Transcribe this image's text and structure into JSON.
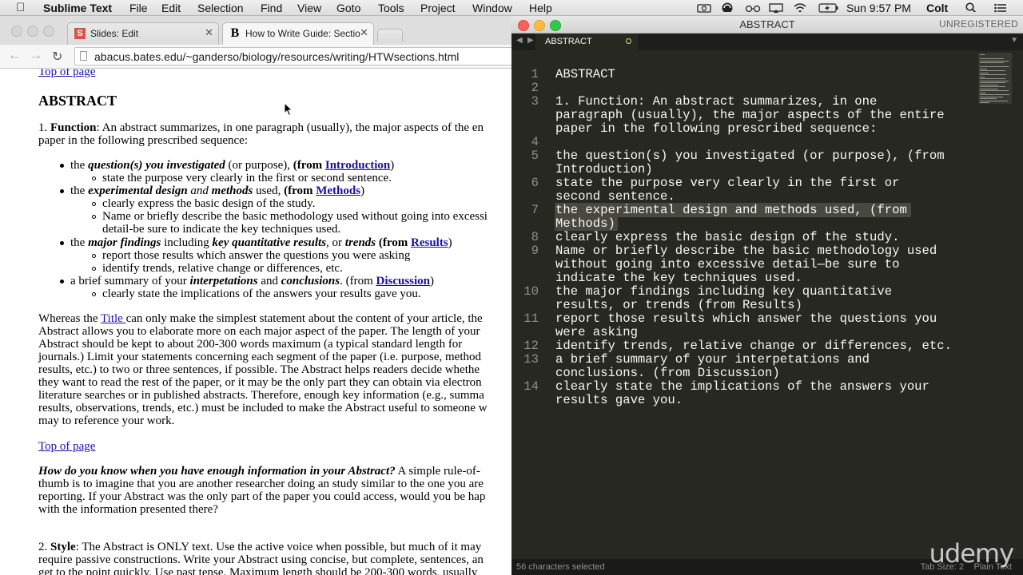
{
  "menubar": {
    "app_name": "Sublime Text",
    "items": [
      "File",
      "Edit",
      "Selection",
      "Find",
      "View",
      "Goto",
      "Tools",
      "Project",
      "Window",
      "Help"
    ],
    "clock": "Sun 9:57 PM",
    "user": "Colt",
    "status_icons": [
      "camera-icon",
      "sync-icon",
      "glasses-icon",
      "airplay-icon",
      "battery-icon",
      "wifi-icon",
      "search-icon",
      "list-icon"
    ]
  },
  "browser": {
    "tabs": [
      {
        "title": "Slides: Edit",
        "favicon": "S",
        "favicon_color": "#d9534f"
      },
      {
        "title": "How to Write Guide: Sectio",
        "favicon": "B",
        "favicon_color": "#000000"
      }
    ],
    "url": "abacus.bates.edu/~ganderso/biology/resources/writing/HTWsections.html",
    "page": {
      "top_link": "Top of page",
      "heading": "ABSTRACT",
      "p1_num": "1. ",
      "p1_label": "Function",
      "p1_line1": ": An abstract summarizes, in one paragraph (usually), the major aspects of the en",
      "p1_line2": "paper in the following prescribed sequence:",
      "b1": {
        "pre": "the ",
        "em": "question(s) you investigated",
        "mid": " (or purpose), ",
        "from": "(from ",
        "link": "Introduction",
        "close": ")"
      },
      "b1_sub": [
        "state the purpose very clearly in the first or second sentence."
      ],
      "b2": {
        "pre": "the ",
        "em": "experimental design",
        "and": " and ",
        "em2": "methods",
        "mid": " used, ",
        "from": "(from ",
        "link": "Methods",
        "close": ")"
      },
      "b2_sub": [
        "clearly express the basic design of the study.",
        "Name or briefly describe the basic methodology used without going into excessi",
        "detail-be sure to indicate the key techniques used."
      ],
      "b3": {
        "pre": "the ",
        "em": "major findings",
        "mid": " including ",
        "em2": "key quantitative results",
        "or": ", or ",
        "em3": "trends",
        "from": " (from ",
        "link": "Results",
        "close": ")"
      },
      "b3_sub": [
        "report those results which answer the questions you were asking",
        "identify trends, relative change or differences, etc."
      ],
      "b4": {
        "pre": "a brief summary of your ",
        "em": "interpetations",
        "and": " and ",
        "em2": "conclusions",
        "mid": ". (from ",
        "link": "Discussion",
        "close": ")"
      },
      "b4_sub": [
        "clearly state the implications of the answers your results gave you."
      ],
      "p2_pre": "Whereas the ",
      "p2_link": "Title ",
      "p2_lines": [
        "can only make the simplest statement about the content of your article, the",
        "Abstract allows you to elaborate more on each major aspect of the paper. The length of your",
        "Abstract should be kept to about 200-300 words maximum (a typical standard length for",
        "journals.) Limit your statements concerning each segment of the paper (i.e. purpose, method",
        "results, etc.) to two or three sentences, if possible. The Abstract helps readers decide whethe",
        "they want to read the rest of the paper, or it may be the only part they can obtain via electron",
        "literature searches or in published abstracts. Therefore, enough key information (e.g., summa",
        "results, observations, trends, etc.) must be included to make the Abstract useful to someone w",
        "may to reference your work."
      ],
      "top_link2": "Top of page",
      "q_em": "How do you know when you have enough information in your Abstract?",
      "q_rest": " A simple rule-of-",
      "q_lines": [
        "thumb is to imagine that you are another researcher doing an study similar to the one you are",
        "reporting. If your Abstract was the only part of the paper you could access, would you be hap",
        "with the information presented there?"
      ],
      "p3_num": "2. ",
      "p3_label": "Style",
      "p3_line1": ": The Abstract is ONLY text. Use the active voice when possible, but much of it may",
      "p3_line2": "require passive constructions. Write your Abstract using concise, but complete, sentences, an",
      "p3_line3": "get to the point quickly. Use past tense. Maximum length should be 200-300 words, usually"
    }
  },
  "sublime": {
    "window_title": "ABSTRACT",
    "unregistered": "UNREGISTERED",
    "tab_name": "ABSTRACT",
    "lines": [
      {
        "n": "1",
        "rows": [
          "ABSTRACT"
        ]
      },
      {
        "n": "2",
        "rows": [
          ""
        ]
      },
      {
        "n": "3",
        "rows": [
          "1. Function: An abstract summarizes, in one",
          "paragraph (usually), the major aspects of the entire",
          "paper in the following prescribed sequence:"
        ]
      },
      {
        "n": "4",
        "rows": [
          ""
        ]
      },
      {
        "n": "5",
        "rows": [
          "the question(s) you investigated (or purpose), (from",
          "Introduction)"
        ]
      },
      {
        "n": "6",
        "rows": [
          "state the purpose very clearly in the first or",
          "second sentence."
        ]
      },
      {
        "n": "7",
        "rows": [
          "the experimental design and methods used, (from",
          "Methods)"
        ],
        "selected": true
      },
      {
        "n": "8",
        "rows": [
          "clearly express the basic design of the study."
        ]
      },
      {
        "n": "9",
        "rows": [
          "Name or briefly describe the basic methodology used",
          "without going into excessive detail—be sure to",
          "indicate the key techniques used."
        ]
      },
      {
        "n": "10",
        "rows": [
          "the major findings including key quantitative",
          "results, or trends (from Results)"
        ]
      },
      {
        "n": "11",
        "rows": [
          "report those results which answer the questions you",
          "were asking"
        ]
      },
      {
        "n": "12",
        "rows": [
          "identify trends, relative change or differences, etc."
        ]
      },
      {
        "n": "13",
        "rows": [
          "a brief summary of your interpetations and",
          "conclusions. (from Discussion)"
        ]
      },
      {
        "n": "14",
        "rows": [
          "clearly state the implications of the answers your",
          "results gave you."
        ]
      }
    ],
    "status_left": "56 characters selected",
    "tab_size": "Tab Size: 2",
    "syntax": "Plain Text",
    "watermark": "udemy",
    "colors": {
      "bg": "#272822",
      "text": "#f8f8f2",
      "gutter": "#8f908a",
      "selection": "#49483e"
    }
  }
}
